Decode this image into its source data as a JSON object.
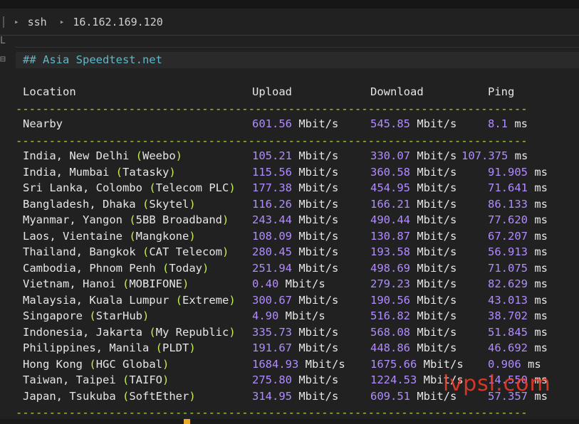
{
  "breadcrumb": [
    "ssh",
    "16.162.169.120"
  ],
  "section_title": "## Asia Speedtest.net",
  "columns": {
    "location": "Location",
    "upload": "Upload",
    "download": "Download",
    "ping": "Ping"
  },
  "dash_line": "-----------------------------------------------------------------------------",
  "nearby": {
    "location": "Nearby",
    "upload": "601.56",
    "download": "545.85",
    "ping": "8.1"
  },
  "rows": [
    {
      "place": "India, New Delhi",
      "isp": "Weebo",
      "upload": "105.21",
      "download": "330.07",
      "ping": "107.375"
    },
    {
      "place": "India, Mumbai",
      "isp": "Tatasky",
      "upload": "115.56",
      "download": "360.58",
      "ping": "91.905"
    },
    {
      "place": "Sri Lanka, Colombo",
      "isp": "Telecom PLC",
      "upload": "177.38",
      "download": "454.95",
      "ping": "71.641"
    },
    {
      "place": "Bangladesh, Dhaka",
      "isp": "Skytel",
      "upload": "116.26",
      "download": "166.21",
      "ping": "86.133"
    },
    {
      "place": "Myanmar, Yangon",
      "isp": "5BB Broadband",
      "upload": "243.44",
      "download": "490.44",
      "ping": "77.620"
    },
    {
      "place": "Laos, Vientaine",
      "isp": "Mangkone",
      "upload": "108.09",
      "download": "130.87",
      "ping": "67.207"
    },
    {
      "place": "Thailand, Bangkok",
      "isp": "CAT Telecom",
      "upload": "280.45",
      "download": "193.58",
      "ping": "56.913"
    },
    {
      "place": "Cambodia, Phnom Penh",
      "isp": "Today",
      "upload": "251.94",
      "download": "498.69",
      "ping": "71.075"
    },
    {
      "place": "Vietnam, Hanoi",
      "isp": "MOBIFONE",
      "upload": "0.40",
      "download": "279.23",
      "ping": "82.629"
    },
    {
      "place": "Malaysia, Kuala Lumpur",
      "isp": "Extreme",
      "upload": "300.67",
      "download": "190.56",
      "ping": "43.013"
    },
    {
      "place": "Singapore",
      "isp": "StarHub",
      "upload": "4.90",
      "download": "516.82",
      "ping": "38.702"
    },
    {
      "place": "Indonesia, Jakarta",
      "isp": "My Republic",
      "upload": "335.73",
      "download": "568.08",
      "ping": "51.845"
    },
    {
      "place": "Philippines, Manila",
      "isp": "PLDT",
      "upload": "191.67",
      "download": "448.86",
      "ping": "46.692"
    },
    {
      "place": "Hong Kong",
      "isp": "HGC Global",
      "upload": "1684.93",
      "download": "1675.66",
      "ping": "0.906"
    },
    {
      "place": "Taiwan, Taipei",
      "isp": "TAIFO",
      "upload": "275.80",
      "download": "1224.53",
      "ping": "14.550"
    },
    {
      "place": "Japan, Tsukuba",
      "isp": "SoftEther",
      "upload": "314.95",
      "download": "609.51",
      "ping": "57.357"
    }
  ],
  "units": {
    "speed": "Mbit/s",
    "ping": "ms"
  },
  "watermark": "lvpsl.com",
  "colors": {
    "number": "#b18cff",
    "paren": "#c5ef4f",
    "dash": "#a9dc3b",
    "title": "#5fb8c9"
  }
}
